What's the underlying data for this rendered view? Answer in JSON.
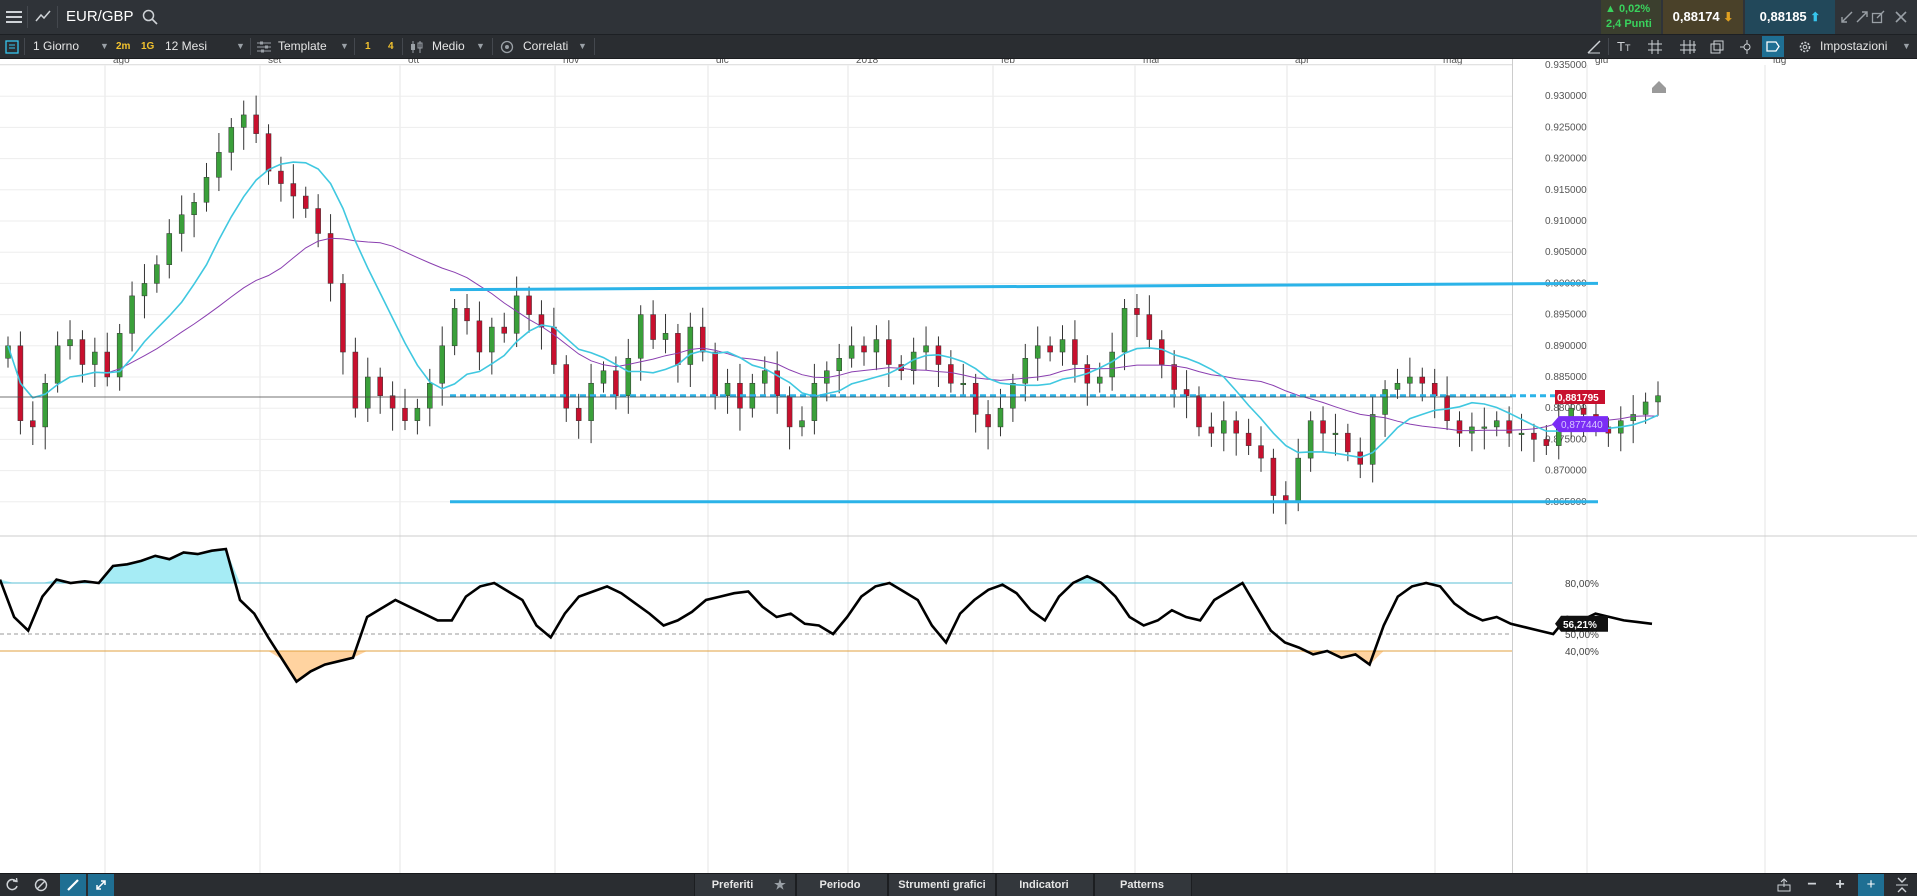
{
  "header": {
    "symbol": "EUR/GBP",
    "change_pct": "▲ 0,02%",
    "change_points": "2,4 Punti",
    "bid": "0,88174",
    "ask": "0,88185"
  },
  "toolbar": {
    "timeframe": "1 Giorno",
    "quick_2m": "2m",
    "quick_1g": "1G",
    "range": "12 Mesi",
    "template": "Template",
    "num1": "1",
    "num4": "4",
    "chart_style": "Medio",
    "correlated": "Correlati",
    "settings": "Impostazioni"
  },
  "bottom": {
    "preferiti": "Preferiti",
    "periodo": "Periodo",
    "strumenti": "Strumenti grafici",
    "indicatori": "Indicatori",
    "patterns": "Patterns"
  },
  "colors": {
    "bull": "#3aa03a",
    "bear": "#c8102e",
    "fast_ma": "#40c8e0",
    "slow_ma": "#8a3fb0",
    "channel": "#2bb3e8",
    "osc_over": "#a6ecf5",
    "osc_under": "#ffd3a0"
  },
  "chart_data": {
    "type": "candlestick",
    "instrument": "EUR/GBP",
    "interval": "1 Giorno",
    "months": [
      "ago",
      "set",
      "ott",
      "nov",
      "dic",
      "2018",
      "feb",
      "mar",
      "apr",
      "mag",
      "giu",
      "lug"
    ],
    "y_axis": {
      "min": 0.86,
      "max": 0.935,
      "ticks": [
        "0.935000",
        "0.930000",
        "0.925000",
        "0.920000",
        "0.915000",
        "0.910000",
        "0.905000",
        "0.900000",
        "0.895000",
        "0.890000",
        "0.885000",
        "0.880000",
        "0.875000",
        "0.870000",
        "0.865000"
      ]
    },
    "last_price": "0,881795",
    "indicator_value": "0,877440",
    "close_series": [
      0.89,
      0.878,
      0.877,
      0.884,
      0.89,
      0.891,
      0.887,
      0.889,
      0.885,
      0.892,
      0.898,
      0.9,
      0.903,
      0.908,
      0.911,
      0.913,
      0.917,
      0.921,
      0.925,
      0.927,
      0.924,
      0.918,
      0.916,
      0.914,
      0.912,
      0.908,
      0.9,
      0.889,
      0.88,
      0.885,
      0.882,
      0.88,
      0.878,
      0.88,
      0.884,
      0.89,
      0.896,
      0.894,
      0.889,
      0.893,
      0.892,
      0.898,
      0.895,
      0.893,
      0.887,
      0.88,
      0.878,
      0.884,
      0.886,
      0.882,
      0.888,
      0.895,
      0.891,
      0.892,
      0.887,
      0.893,
      0.889,
      0.882,
      0.884,
      0.88,
      0.884,
      0.886,
      0.882,
      0.877,
      0.878,
      0.884,
      0.886,
      0.888,
      0.89,
      0.889,
      0.891,
      0.887,
      0.886,
      0.889,
      0.89,
      0.887,
      0.884,
      0.884,
      0.879,
      0.877,
      0.88,
      0.884,
      0.888,
      0.89,
      0.889,
      0.891,
      0.887,
      0.884,
      0.885,
      0.889,
      0.896,
      0.895,
      0.891,
      0.887,
      0.883,
      0.882,
      0.877,
      0.876,
      0.878,
      0.876,
      0.874,
      0.872,
      0.866,
      0.865,
      0.872,
      0.878,
      0.876,
      0.876,
      0.873,
      0.871,
      0.879,
      0.883,
      0.884,
      0.885,
      0.884,
      0.882,
      0.878,
      0.876,
      0.877,
      0.877,
      0.878,
      0.876,
      0.876,
      0.875,
      0.874,
      0.878,
      0.88,
      0.879,
      0.877,
      0.876,
      0.878,
      0.879,
      0.881,
      0.882
    ],
    "channel": {
      "upper_start": 0.899,
      "upper_end": 0.9,
      "lower_start": 0.865,
      "lower_end": 0.865,
      "mid": 0.882
    },
    "oscillator": {
      "levels": [
        "80,00%",
        "50,00%",
        "40,00%"
      ],
      "current": "56,21%",
      "values": [
        82,
        60,
        52,
        72,
        82,
        80,
        81,
        80,
        90,
        91,
        93,
        96,
        94,
        98,
        97,
        99,
        100,
        70,
        62,
        48,
        35,
        22,
        28,
        32,
        34,
        36,
        60,
        65,
        70,
        66,
        62,
        58,
        58,
        72,
        78,
        80,
        75,
        70,
        55,
        48,
        62,
        72,
        75,
        78,
        74,
        68,
        62,
        55,
        58,
        63,
        70,
        72,
        74,
        75,
        66,
        60,
        62,
        56,
        55,
        50,
        60,
        72,
        78,
        80,
        75,
        70,
        55,
        45,
        62,
        70,
        76,
        79,
        74,
        64,
        58,
        72,
        80,
        84,
        80,
        72,
        60,
        55,
        58,
        64,
        60,
        58,
        70,
        75,
        80,
        66,
        52,
        45,
        42,
        38,
        40,
        36,
        38,
        32,
        55,
        72,
        78,
        80,
        78,
        68,
        62,
        58,
        60,
        56,
        54,
        52,
        50,
        60,
        58,
        62,
        60,
        58,
        57,
        56
      ]
    }
  }
}
